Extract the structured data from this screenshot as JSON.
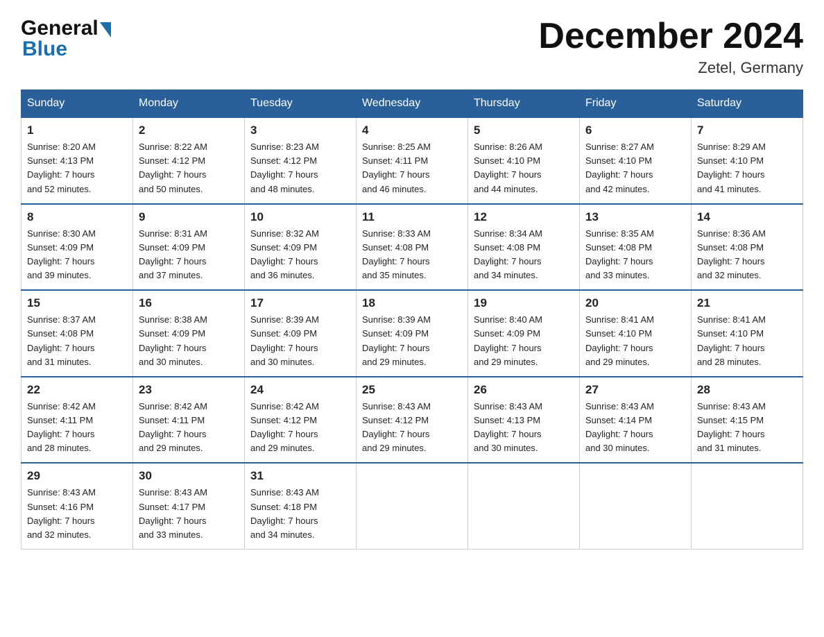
{
  "header": {
    "logo_general": "General",
    "logo_blue": "Blue",
    "month_title": "December 2024",
    "location": "Zetel, Germany"
  },
  "weekdays": [
    "Sunday",
    "Monday",
    "Tuesday",
    "Wednesday",
    "Thursday",
    "Friday",
    "Saturday"
  ],
  "weeks": [
    [
      {
        "day": "1",
        "sunrise": "8:20 AM",
        "sunset": "4:13 PM",
        "daylight": "7 hours and 52 minutes."
      },
      {
        "day": "2",
        "sunrise": "8:22 AM",
        "sunset": "4:12 PM",
        "daylight": "7 hours and 50 minutes."
      },
      {
        "day": "3",
        "sunrise": "8:23 AM",
        "sunset": "4:12 PM",
        "daylight": "7 hours and 48 minutes."
      },
      {
        "day": "4",
        "sunrise": "8:25 AM",
        "sunset": "4:11 PM",
        "daylight": "7 hours and 46 minutes."
      },
      {
        "day": "5",
        "sunrise": "8:26 AM",
        "sunset": "4:10 PM",
        "daylight": "7 hours and 44 minutes."
      },
      {
        "day": "6",
        "sunrise": "8:27 AM",
        "sunset": "4:10 PM",
        "daylight": "7 hours and 42 minutes."
      },
      {
        "day": "7",
        "sunrise": "8:29 AM",
        "sunset": "4:10 PM",
        "daylight": "7 hours and 41 minutes."
      }
    ],
    [
      {
        "day": "8",
        "sunrise": "8:30 AM",
        "sunset": "4:09 PM",
        "daylight": "7 hours and 39 minutes."
      },
      {
        "day": "9",
        "sunrise": "8:31 AM",
        "sunset": "4:09 PM",
        "daylight": "7 hours and 37 minutes."
      },
      {
        "day": "10",
        "sunrise": "8:32 AM",
        "sunset": "4:09 PM",
        "daylight": "7 hours and 36 minutes."
      },
      {
        "day": "11",
        "sunrise": "8:33 AM",
        "sunset": "4:08 PM",
        "daylight": "7 hours and 35 minutes."
      },
      {
        "day": "12",
        "sunrise": "8:34 AM",
        "sunset": "4:08 PM",
        "daylight": "7 hours and 34 minutes."
      },
      {
        "day": "13",
        "sunrise": "8:35 AM",
        "sunset": "4:08 PM",
        "daylight": "7 hours and 33 minutes."
      },
      {
        "day": "14",
        "sunrise": "8:36 AM",
        "sunset": "4:08 PM",
        "daylight": "7 hours and 32 minutes."
      }
    ],
    [
      {
        "day": "15",
        "sunrise": "8:37 AM",
        "sunset": "4:08 PM",
        "daylight": "7 hours and 31 minutes."
      },
      {
        "day": "16",
        "sunrise": "8:38 AM",
        "sunset": "4:09 PM",
        "daylight": "7 hours and 30 minutes."
      },
      {
        "day": "17",
        "sunrise": "8:39 AM",
        "sunset": "4:09 PM",
        "daylight": "7 hours and 30 minutes."
      },
      {
        "day": "18",
        "sunrise": "8:39 AM",
        "sunset": "4:09 PM",
        "daylight": "7 hours and 29 minutes."
      },
      {
        "day": "19",
        "sunrise": "8:40 AM",
        "sunset": "4:09 PM",
        "daylight": "7 hours and 29 minutes."
      },
      {
        "day": "20",
        "sunrise": "8:41 AM",
        "sunset": "4:10 PM",
        "daylight": "7 hours and 29 minutes."
      },
      {
        "day": "21",
        "sunrise": "8:41 AM",
        "sunset": "4:10 PM",
        "daylight": "7 hours and 28 minutes."
      }
    ],
    [
      {
        "day": "22",
        "sunrise": "8:42 AM",
        "sunset": "4:11 PM",
        "daylight": "7 hours and 28 minutes."
      },
      {
        "day": "23",
        "sunrise": "8:42 AM",
        "sunset": "4:11 PM",
        "daylight": "7 hours and 29 minutes."
      },
      {
        "day": "24",
        "sunrise": "8:42 AM",
        "sunset": "4:12 PM",
        "daylight": "7 hours and 29 minutes."
      },
      {
        "day": "25",
        "sunrise": "8:43 AM",
        "sunset": "4:12 PM",
        "daylight": "7 hours and 29 minutes."
      },
      {
        "day": "26",
        "sunrise": "8:43 AM",
        "sunset": "4:13 PM",
        "daylight": "7 hours and 30 minutes."
      },
      {
        "day": "27",
        "sunrise": "8:43 AM",
        "sunset": "4:14 PM",
        "daylight": "7 hours and 30 minutes."
      },
      {
        "day": "28",
        "sunrise": "8:43 AM",
        "sunset": "4:15 PM",
        "daylight": "7 hours and 31 minutes."
      }
    ],
    [
      {
        "day": "29",
        "sunrise": "8:43 AM",
        "sunset": "4:16 PM",
        "daylight": "7 hours and 32 minutes."
      },
      {
        "day": "30",
        "sunrise": "8:43 AM",
        "sunset": "4:17 PM",
        "daylight": "7 hours and 33 minutes."
      },
      {
        "day": "31",
        "sunrise": "8:43 AM",
        "sunset": "4:18 PM",
        "daylight": "7 hours and 34 minutes."
      },
      null,
      null,
      null,
      null
    ]
  ],
  "cell_labels": {
    "sunrise": "Sunrise: ",
    "sunset": "Sunset: ",
    "daylight": "Daylight: "
  }
}
